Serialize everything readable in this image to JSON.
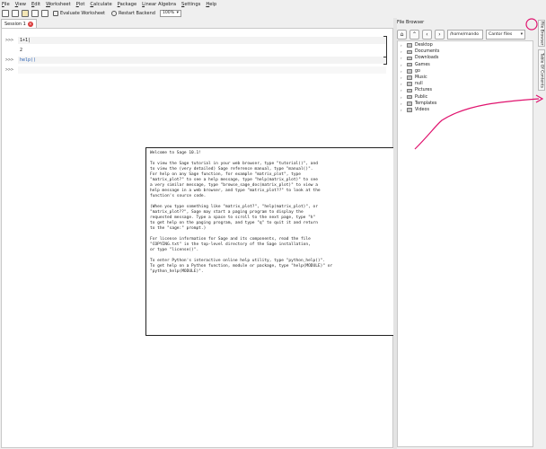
{
  "menu": [
    "File",
    "View",
    "Edit",
    "Worksheet",
    "Plot",
    "Calculate",
    "Package",
    "Linear Algebra",
    "Settings",
    "Help"
  ],
  "toolbar": {
    "evaluate_label": "Evaluate Worksheet",
    "restart_label": "Restart Backend",
    "zoom_value": "100%"
  },
  "tabs": [
    {
      "label": "Session 1"
    }
  ],
  "worksheet": {
    "cells": [
      {
        "prompt": ">>>",
        "input": "1+1|",
        "output": "2"
      },
      {
        "prompt": ">>>",
        "input": "help()"
      },
      {
        "prompt": ">>>",
        "input": ""
      }
    ],
    "help_text": "Welcome to Sage 10.1!\n\nTo view the Sage tutorial in your web browser, type \"tutorial()\", and\nto view the (very detailed) Sage reference manual, type \"manual()\".\nFor help on any Sage function, for example \"matrix_plot\", type\n\"matrix_plot?\" to see a help message, type \"help(matrix_plot)\" to see\na very similar message, type \"browse_sage_doc(matrix_plot)\" to view a\nhelp message in a web browser, and type \"matrix_plot??\" to look at the\nfunction's source code.\n\n(When you type something like \"matrix_plot?\", \"help(matrix_plot)\", or\n\"matrix_plot??\", Sage may start a paging program to display the\nrequested message. Type a space to scroll to the next page, type \"h\"\nto get help on the paging program, and type \"q\" to quit it and return\nto the \"sage:\" prompt.)\n\nFor license information for Sage and its components, read the file\n\"COPYING.txt\" in the top-level directory of the Sage installation,\nor type \"license()\".\n\nTo enter Python's interactive online help utility, type \"python_help()\".\nTo get help on a Python function, module or package, type \"help(MODULE)\" or\n\"python_help(MODULE)\"."
  },
  "file_browser": {
    "title": "File Browser",
    "path": "/home/mando",
    "filter": "Cantor files",
    "items": [
      "Desktop",
      "Documents",
      "Downloads",
      "Games",
      "go",
      "Music",
      "null",
      "Pictures",
      "Public",
      "Templates",
      "Videos"
    ]
  },
  "side_tabs": [
    "File Browser",
    "Table Of Contents"
  ],
  "colors": {
    "annotation": "#e0136e",
    "close_badge": "#d93a3a",
    "help_link": "#2a62b4"
  }
}
